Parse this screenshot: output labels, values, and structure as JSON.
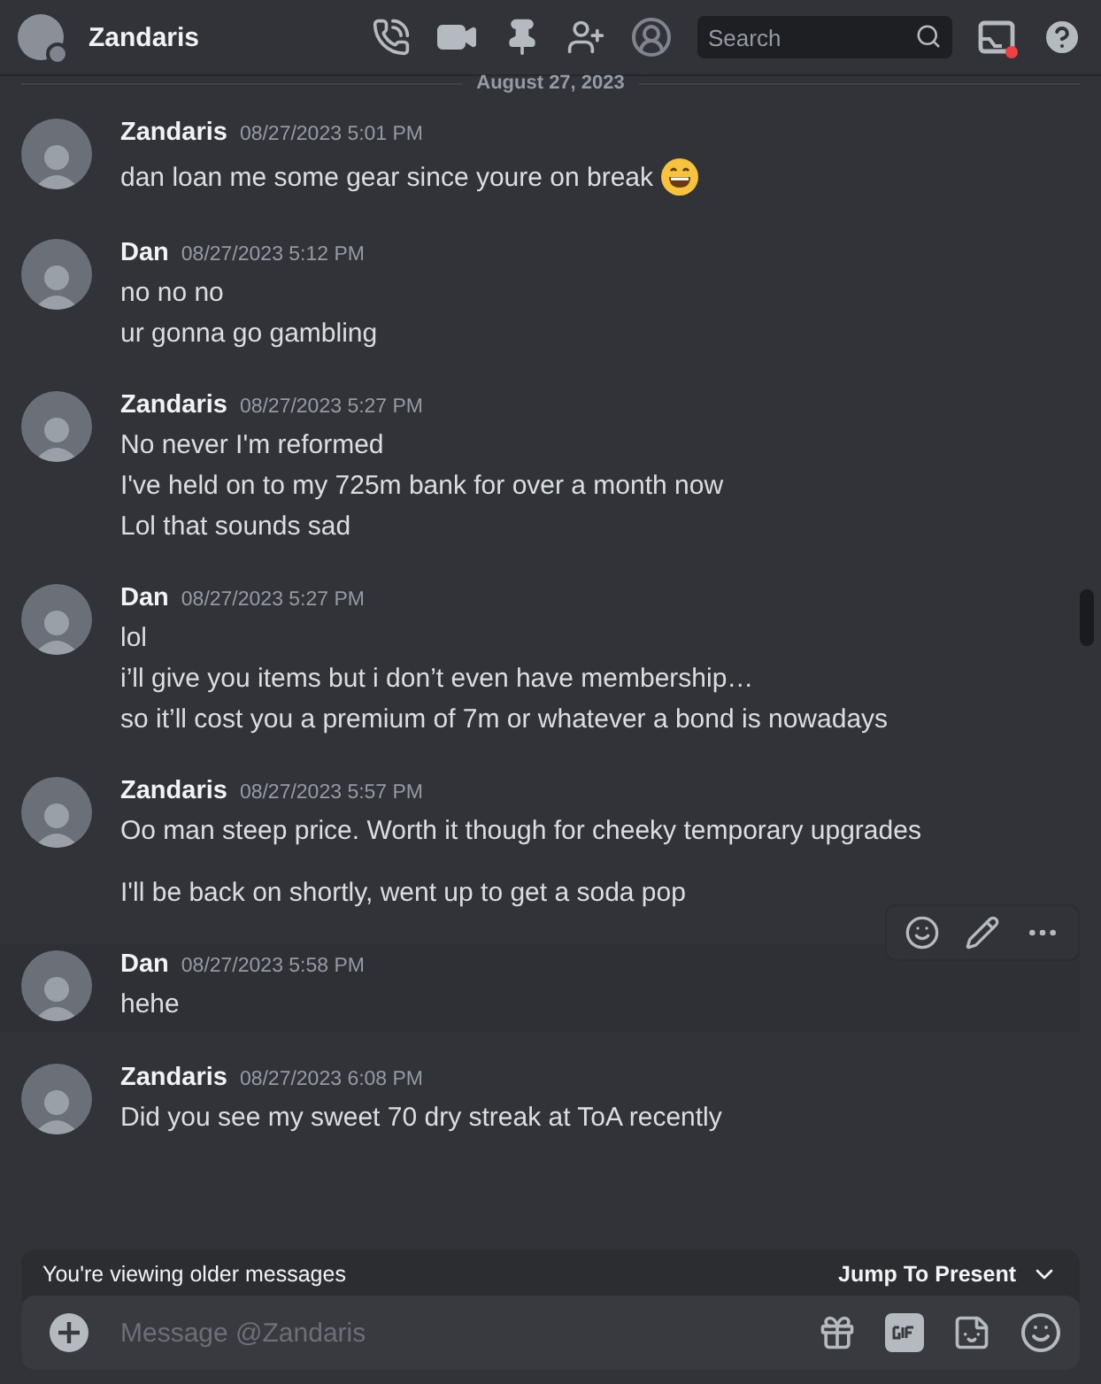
{
  "header": {
    "title": "Zandaris",
    "search": {
      "placeholder": "Search"
    },
    "inbox_unread": true
  },
  "date_divider": "August 27, 2023",
  "messages": [
    {
      "author": "Zandaris",
      "time": "08/27/2023 5:01 PM",
      "hovered": false,
      "emoji": true,
      "paragraphs": [
        [
          "dan loan me some gear since youre on break"
        ]
      ]
    },
    {
      "author": "Dan",
      "time": "08/27/2023 5:12 PM",
      "hovered": false,
      "paragraphs": [
        [
          "no no no",
          "ur gonna go gambling"
        ]
      ]
    },
    {
      "author": "Zandaris",
      "time": "08/27/2023 5:27 PM",
      "hovered": false,
      "paragraphs": [
        [
          "No never I'm reformed",
          "I've held on to my 725m bank for over a month now",
          "Lol that sounds sad"
        ]
      ]
    },
    {
      "author": "Dan",
      "time": "08/27/2023 5:27 PM",
      "hovered": false,
      "paragraphs": [
        [
          "lol",
          "i’ll give you items but i don’t even have membership…",
          "so it’ll cost you a premium of 7m or whatever a bond is nowadays"
        ]
      ]
    },
    {
      "author": "Zandaris",
      "time": "08/27/2023 5:57 PM",
      "hovered": false,
      "paragraphs": [
        [
          "Oo man steep price. Worth it though for cheeky temporary upgrades"
        ],
        [
          "I'll be back on shortly, went up to get a soda pop"
        ]
      ]
    },
    {
      "author": "Dan",
      "time": "08/27/2023 5:58 PM",
      "hovered": true,
      "paragraphs": [
        [
          "hehe"
        ]
      ]
    },
    {
      "author": "Zandaris",
      "time": "08/27/2023 6:08 PM",
      "hovered": false,
      "paragraphs": [
        [
          "Did you see my sweet 70 dry streak at ToA recently"
        ]
      ]
    }
  ],
  "older_banner": {
    "text": "You're viewing older messages",
    "action": "Jump To Present"
  },
  "composer": {
    "placeholder": "Message @Zandaris"
  }
}
